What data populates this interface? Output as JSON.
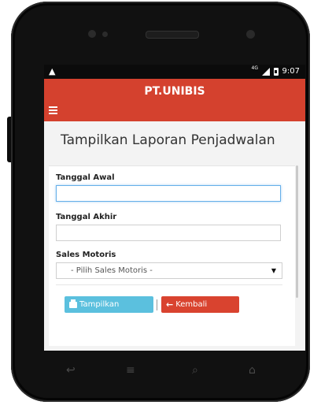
{
  "status_bar": {
    "alert_icon": "warning-triangle-icon",
    "network_label": "4G",
    "time": "9:07"
  },
  "app_bar": {
    "title": "PT.UNIBIS",
    "menu_icon": "hamburger-menu-icon"
  },
  "page": {
    "title": "Tampilkan Laporan Penjadwalan"
  },
  "form": {
    "start_date_label": "Tanggal Awal",
    "start_date_value": "",
    "end_date_label": "Tanggal Akhir",
    "end_date_value": "",
    "sales_label": "Sales Motoris",
    "sales_selected": "- Pilih Sales Motoris -",
    "show_button": "Tampilkan",
    "back_button": "Kembali",
    "show_color": "#5bc0de",
    "back_color": "#d9432f"
  },
  "nav_bar": {
    "back_icon": "back-icon",
    "home_icon": "home-icon",
    "search_icon": "search-icon",
    "menu_icon": "menu-icon"
  },
  "colors": {
    "accent": "#d4412e",
    "focus": "#66afe9"
  }
}
